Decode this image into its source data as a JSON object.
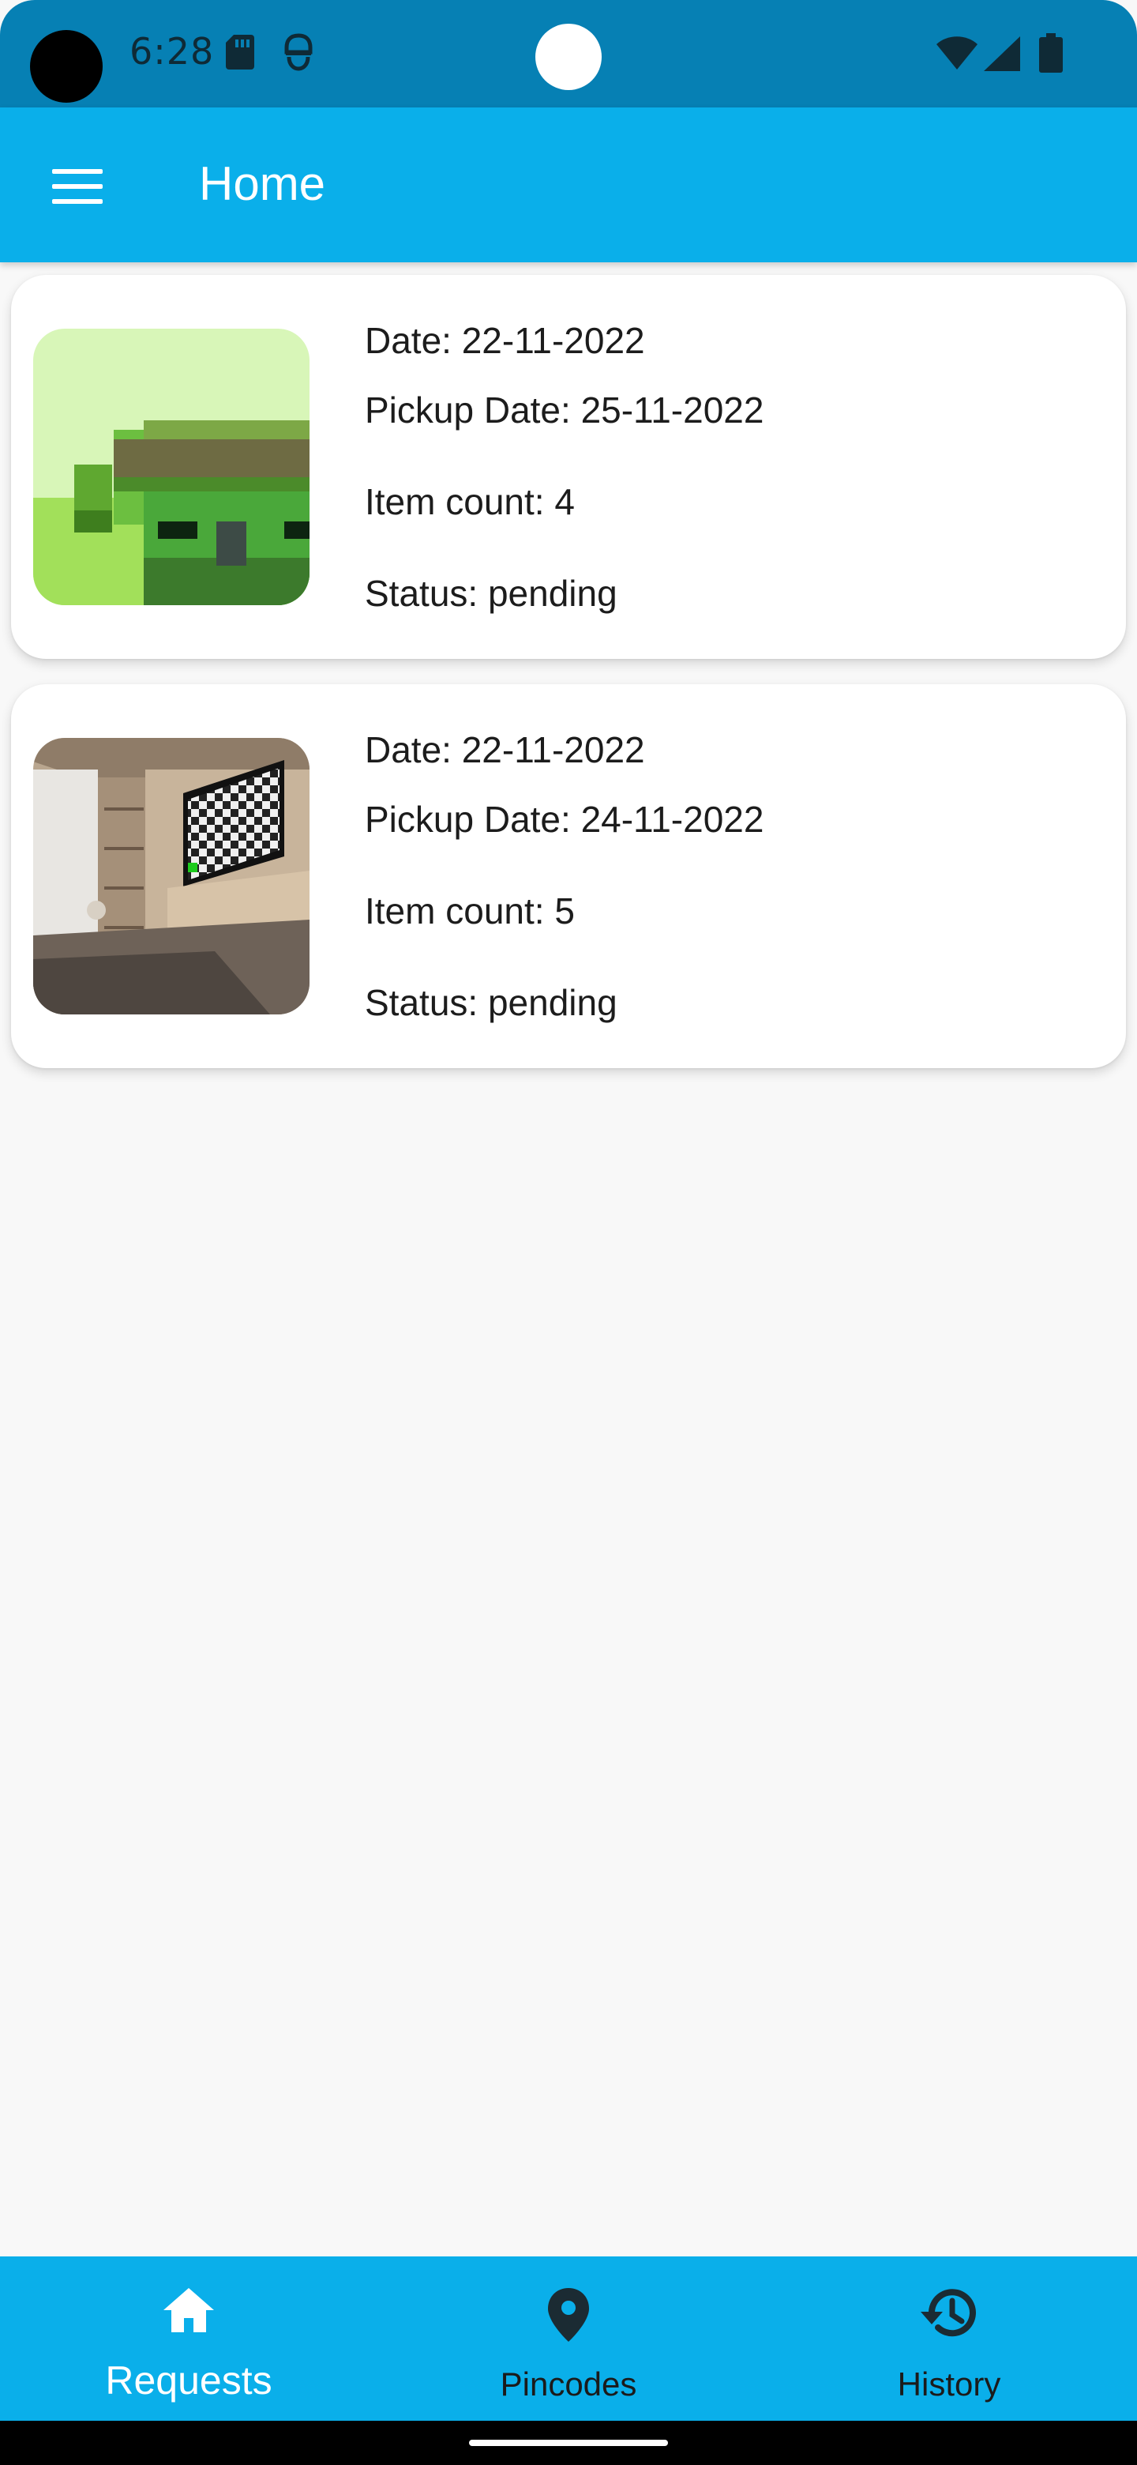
{
  "status_bar": {
    "time": "6:28",
    "icons": [
      "sd-card-icon",
      "vpn-icon",
      "wifi-icon",
      "signal-icon",
      "battery-icon"
    ],
    "background_color": "#0680b4"
  },
  "app_bar": {
    "title": "Home",
    "menu_icon": "menu-icon",
    "background_color": "#0aafea"
  },
  "requests": [
    {
      "thumbnail": "green-pixel-house-image",
      "date": "Date: 22-11-2022",
      "pickup_date": "Pickup Date: 25-11-2022",
      "item_count": "Item count: 4",
      "status": "Status: pending"
    },
    {
      "thumbnail": "living-room-tv-image",
      "date": "Date: 22-11-2022",
      "pickup_date": "Pickup Date: 24-11-2022",
      "item_count": "Item count: 5",
      "status": "Status: pending"
    }
  ],
  "bottom_nav": {
    "items": [
      {
        "label": "Requests",
        "icon": "home-icon",
        "selected": true
      },
      {
        "label": "Pincodes",
        "icon": "location-pin-icon",
        "selected": false
      },
      {
        "label": "History",
        "icon": "history-icon",
        "selected": false
      }
    ],
    "background_color": "#0aafea"
  }
}
